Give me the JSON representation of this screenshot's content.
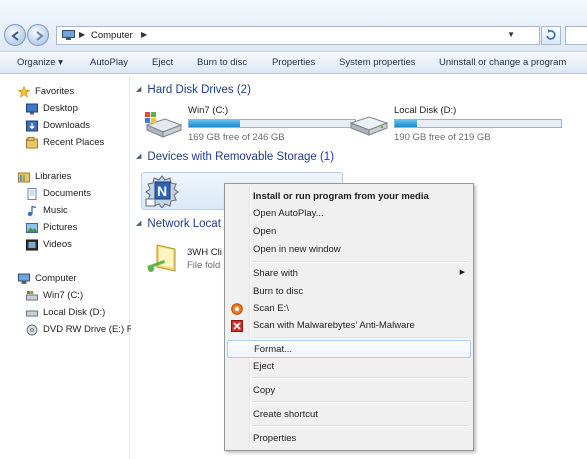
{
  "address": {
    "crumb": "Computer"
  },
  "toolbar": {
    "items": [
      "Organize ▾",
      "AutoPlay",
      "Eject",
      "Burn to disc",
      "Properties",
      "System properties",
      "Uninstall or change a program"
    ]
  },
  "nav": {
    "favorites": "Favorites",
    "desktop": "Desktop",
    "downloads": "Downloads",
    "recent": "Recent Places",
    "libraries": "Libraries",
    "documents": "Documents",
    "music": "Music",
    "pictures": "Pictures",
    "videos": "Videos",
    "computer": "Computer",
    "win7": "Win7 (C:)",
    "localdisk": "Local Disk (D:)",
    "dvd": "DVD RW Drive (E:) Re"
  },
  "content": {
    "group_hdd": "Hard Disk Drives (2)",
    "group_removable": "Devices with Removable Storage (1)",
    "group_network": "Network Locat",
    "drive_c": {
      "name": "Win7 (C:)",
      "free": "169 GB free of 246 GB",
      "used_fraction": 0.31
    },
    "drive_d": {
      "name": "Local Disk (D:)",
      "free": "190 GB free of 219 GB",
      "used_fraction": 0.13
    },
    "network_item": {
      "name": "3WH Cli",
      "sub": "File fold"
    }
  },
  "context_menu": {
    "install": "Install or run program from your media",
    "open_autoplay": "Open AutoPlay...",
    "open": "Open",
    "open_new_window": "Open in new window",
    "share_with": "Share with",
    "burn": "Burn to disc",
    "scan": "Scan E:\\",
    "malwarebytes": "Scan with Malwarebytes' Anti-Malware",
    "format": "Format...",
    "eject": "Eject",
    "copy": "Copy",
    "create_shortcut": "Create shortcut",
    "properties": "Properties"
  }
}
